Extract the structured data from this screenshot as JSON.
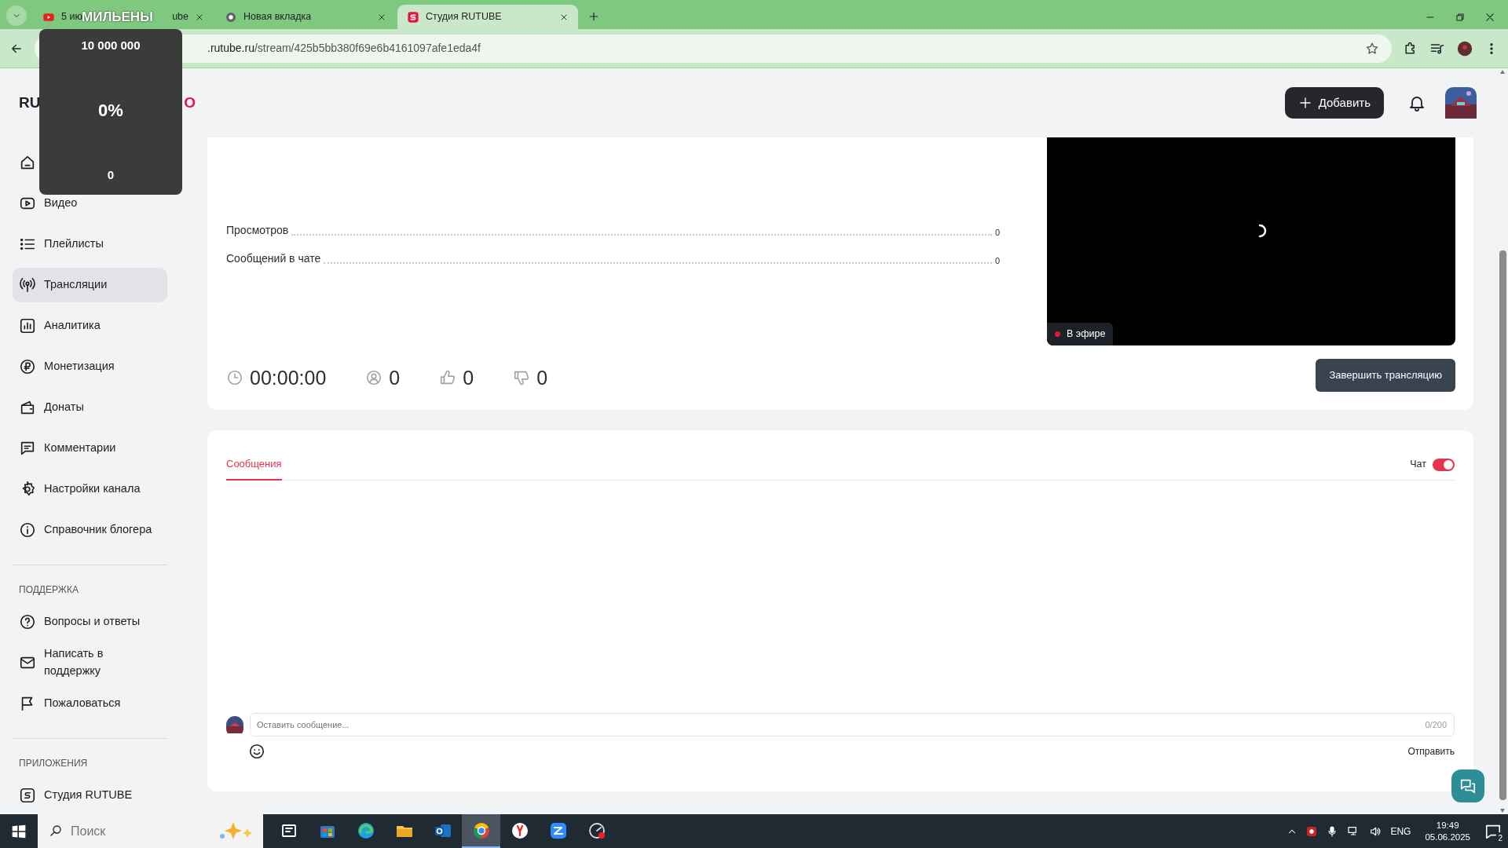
{
  "browser": {
    "tabs": [
      {
        "title": "5 ию",
        "title_tail": "ube",
        "selected": false
      },
      {
        "title": "Новая вкладка",
        "selected": false
      },
      {
        "title": "Студия RUTUBE",
        "selected": true
      }
    ],
    "url_host": ".rutube.ru",
    "url_path": "/stream/425b5bb380f69e6b4161097afe1eda4f"
  },
  "overlay": {
    "title": "МИЛЬЕНЫ",
    "goal": "10 000 000",
    "percent": "0%",
    "count": "0"
  },
  "logo": {
    "start": "RU",
    "end": "O"
  },
  "header": {
    "add_button": "Добавить"
  },
  "sidebar": {
    "sections": [
      {
        "items": [
          {
            "selected": false
          },
          {
            "label": "Видео",
            "selected": false
          },
          {
            "label": "Плейлисты",
            "selected": false
          },
          {
            "label": "Трансляции",
            "selected": true
          },
          {
            "label": "Аналитика",
            "selected": false
          },
          {
            "label": "Монетизация",
            "selected": false
          },
          {
            "label": "Донаты",
            "selected": false
          },
          {
            "label": "Комментарии",
            "selected": false
          },
          {
            "label": "Настройки канала",
            "selected": false
          },
          {
            "label": "Справочник блогера",
            "selected": false
          }
        ]
      },
      {
        "heading": "ПОДДЕРЖКА",
        "items": [
          {
            "label": "Вопросы и ответы",
            "selected": false
          },
          {
            "label": "Написать в поддержку",
            "selected": false
          },
          {
            "label": "Пожаловаться",
            "selected": false
          }
        ]
      },
      {
        "heading": "ПРИЛОЖЕНИЯ",
        "items": [
          {
            "label": "Студия RUTUBE",
            "selected": false
          }
        ]
      }
    ]
  },
  "stats": [
    {
      "label": "Просмотров",
      "value": "0"
    },
    {
      "label": "Сообщений в чате",
      "value": "0"
    }
  ],
  "counters": [
    {
      "value": "00:00:00"
    },
    {
      "value": "0"
    },
    {
      "value": "0"
    },
    {
      "value": "0"
    }
  ],
  "player": {
    "live_label": "В эфире"
  },
  "end_button": "Завершить трансляцию",
  "chat": {
    "tabs": [
      {
        "label": "Сообщения",
        "selected": true
      }
    ],
    "toggle": {
      "label": "Чат",
      "on": true
    },
    "placeholder": "Оставить сообщение...",
    "counter": "0/200",
    "send": "Отправить"
  },
  "taskbar": {
    "search_placeholder": "Поиск",
    "apps": [
      {
        "selected": false
      },
      {
        "selected": false
      },
      {
        "selected": false
      },
      {
        "selected": false
      },
      {
        "selected": false
      },
      {
        "selected": true
      },
      {
        "selected": false
      },
      {
        "selected": false
      },
      {
        "selected": false
      }
    ],
    "lang": "ENG",
    "time": "19:49",
    "date": "05.06.2025",
    "notifications": "2"
  }
}
